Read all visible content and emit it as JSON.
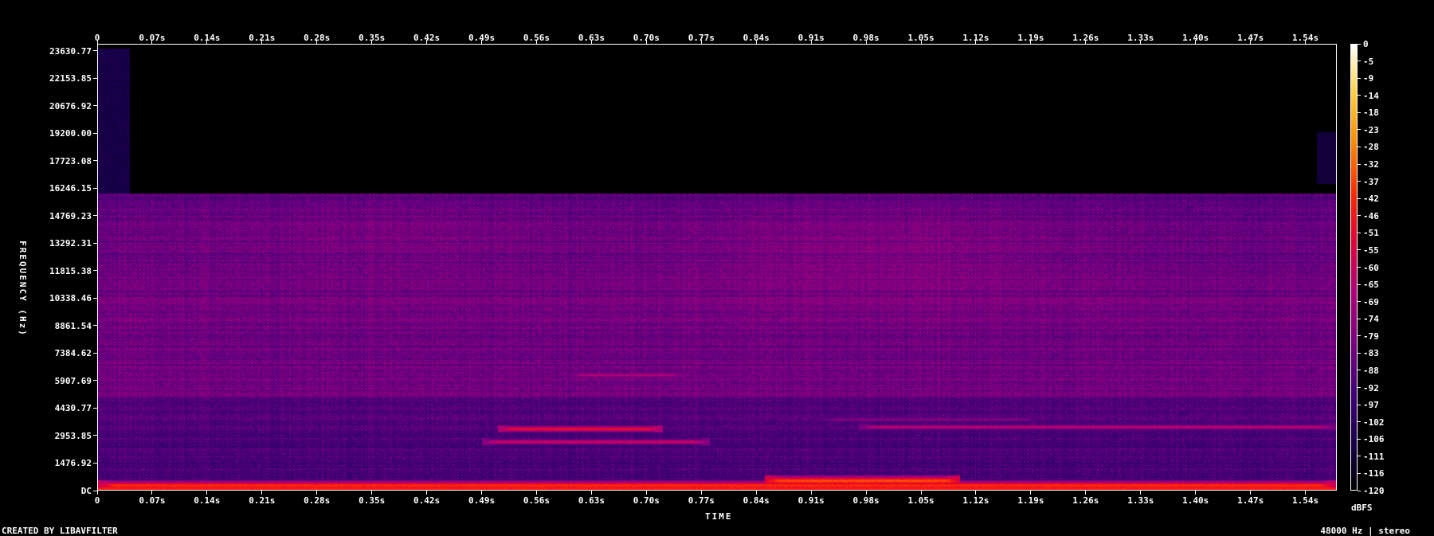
{
  "chart_data": {
    "type": "heatmap",
    "title": "",
    "xlabel": "TIME",
    "ylabel": "FREQUENCY (Hz)",
    "x_tick_labels": [
      "0",
      "0.07s",
      "0.14s",
      "0.21s",
      "0.28s",
      "0.35s",
      "0.42s",
      "0.49s",
      "0.56s",
      "0.63s",
      "0.70s",
      "0.77s",
      "0.84s",
      "0.91s",
      "0.98s",
      "1.05s",
      "1.12s",
      "1.19s",
      "1.26s",
      "1.33s",
      "1.40s",
      "1.47s",
      "1.54s"
    ],
    "x_tick_values": [
      0,
      0.07,
      0.14,
      0.21,
      0.28,
      0.35,
      0.42,
      0.49,
      0.56,
      0.63,
      0.7,
      0.77,
      0.84,
      0.91,
      0.98,
      1.05,
      1.12,
      1.19,
      1.26,
      1.33,
      1.4,
      1.47,
      1.54
    ],
    "xlim": [
      0,
      1.58
    ],
    "y_tick_labels": [
      "23630.77",
      "22153.85",
      "20676.92",
      "19200.00",
      "17723.08",
      "16246.15",
      "14769.23",
      "13292.31",
      "11815.38",
      "10338.46",
      "8861.54",
      "7384.62",
      "5907.69",
      "4430.77",
      "2953.85",
      "1476.92",
      "DC"
    ],
    "y_tick_values": [
      23630.77,
      22153.85,
      20676.92,
      19200.0,
      17723.08,
      16246.15,
      14769.23,
      13292.31,
      11815.38,
      10338.46,
      8861.54,
      7384.62,
      5907.69,
      4430.77,
      2953.85,
      1476.92,
      0
    ],
    "ylim": [
      0,
      24000
    ],
    "colorbar_label": "dBFS",
    "colorbar_tick_labels": [
      "0",
      "-5",
      "-9",
      "-14",
      "-18",
      "-23",
      "-28",
      "-32",
      "-37",
      "-42",
      "-46",
      "-51",
      "-55",
      "-60",
      "-65",
      "-69",
      "-74",
      "-79",
      "-83",
      "-88",
      "-92",
      "-97",
      "-102",
      "-106",
      "-111",
      "-116",
      "-120"
    ],
    "colorbar_range": [
      -120,
      0
    ],
    "features": {
      "cutoff_hz": 16000,
      "floor_dbfs": -88,
      "bands": [
        {
          "f_hz": 3300,
          "t_start": 0.51,
          "t_end": 0.72,
          "level_dbfs": -48
        },
        {
          "f_hz": 2600,
          "t_start": 0.49,
          "t_end": 0.78,
          "level_dbfs": -58
        },
        {
          "f_hz": 3400,
          "t_start": 0.97,
          "t_end": 1.58,
          "level_dbfs": -62
        },
        {
          "f_hz": 3800,
          "t_start": 0.92,
          "t_end": 1.2,
          "level_dbfs": -75
        },
        {
          "f_hz": 250,
          "t_start": 0.0,
          "t_end": 1.58,
          "level_dbfs": -40
        },
        {
          "f_hz": 500,
          "t_start": 0.85,
          "t_end": 1.1,
          "level_dbfs": -35
        },
        {
          "f_hz": 6200,
          "t_start": 0.6,
          "t_end": 0.75,
          "level_dbfs": -65
        }
      ],
      "colors": [
        "#000000",
        "#1a0050",
        "#420078",
        "#7a0080",
        "#b0007a",
        "#e0003a",
        "#ff2a00",
        "#ff8a00",
        "#ffd040",
        "#ffffff"
      ]
    }
  },
  "footer": {
    "left": "CREATED BY LIBAVFILTER",
    "right": "48000 Hz | stereo"
  }
}
